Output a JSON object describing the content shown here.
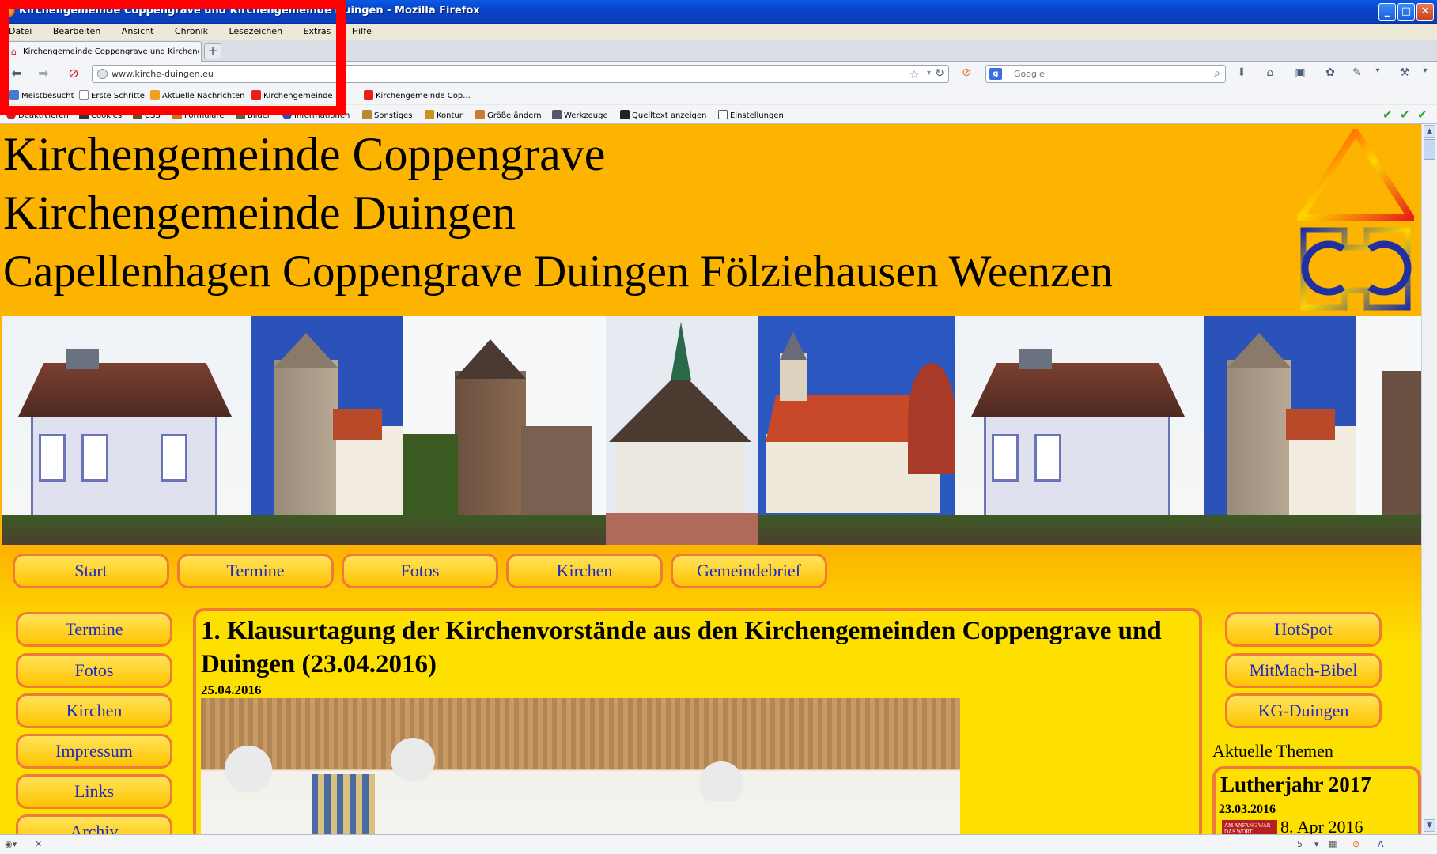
{
  "window": {
    "title": "Kirchengemeinde Coppengrave und Kirchengemeinde Duingen - Mozilla Firefox",
    "controls": {
      "minimize": "_",
      "maximize": "□",
      "close": "✕"
    }
  },
  "menubar": [
    "Datei",
    "Bearbeiten",
    "Ansicht",
    "Chronik",
    "Lesezeichen",
    "Extras",
    "Hilfe"
  ],
  "tabs": [
    {
      "label": "Kirchengemeinde Coppengrave und Kircheng...",
      "icon": "church-favicon"
    }
  ],
  "newtab_label": "+",
  "navbar": {
    "url": "www.kirche-duingen.eu",
    "search_placeholder": "Google",
    "icons": [
      "back-icon",
      "forward-icon",
      "stop-icon",
      "bookmark-star-icon",
      "reload-icon",
      "download-icon",
      "home-icon",
      "addon-icon",
      "tools-icon"
    ]
  },
  "bookmarks": [
    "Meistbesucht",
    "Erste Schritte",
    "Aktuelle Nachrichten",
    "Kirchengemeinde ...",
    "Kirchengemeinde Cop..."
  ],
  "devtoolbar": [
    "Deaktivieren",
    "Cookies",
    "CSS",
    "Formulare",
    "Bilder",
    "Informationen",
    "Sonstiges",
    "Kontur",
    "Größe ändern",
    "Werkzeuge",
    "Quelltext anzeigen",
    "Einstellungen"
  ],
  "page": {
    "header_lines": [
      "Kirchengemeinde Coppengrave",
      "Kirchengemeinde Duingen",
      "Capellenhagen Coppengrave Duingen Fölziehausen Weenzen"
    ],
    "top_nav": [
      "Start",
      "Termine",
      "Fotos",
      "Kirchen",
      "Gemeindebrief"
    ],
    "left_nav": [
      "Termine",
      "Fotos",
      "Kirchen",
      "Impressum",
      "Links",
      "Archiv"
    ],
    "right_nav": [
      "HotSpot",
      "MitMach-Bibel",
      "KG-Duingen"
    ],
    "article": {
      "title": "1. Klausurtagung der Kirchenvorstände aus den Kirchengemeinden Coppengrave und Duingen (23.04.2016)",
      "date": "25.04.2016"
    },
    "aktuelle_themen": {
      "heading": "Aktuelle Themen",
      "item_title": "Lutherjahr 2017",
      "item_date": "23.03.2016",
      "thumb_text": "AM ANFANG WAR DAS WORT",
      "item_sub": "8. Apr 2016"
    }
  },
  "statusbar": {
    "zoom": "5"
  },
  "colors": {
    "page_orange": "#fdb400",
    "page_yellow": "#fde000",
    "button_border": "#f07a3a",
    "link_blue": "#1a2bc8",
    "highlight_red": "#ff0000",
    "logo_red": "#e8201a",
    "logo_blue": "#2030a0"
  }
}
